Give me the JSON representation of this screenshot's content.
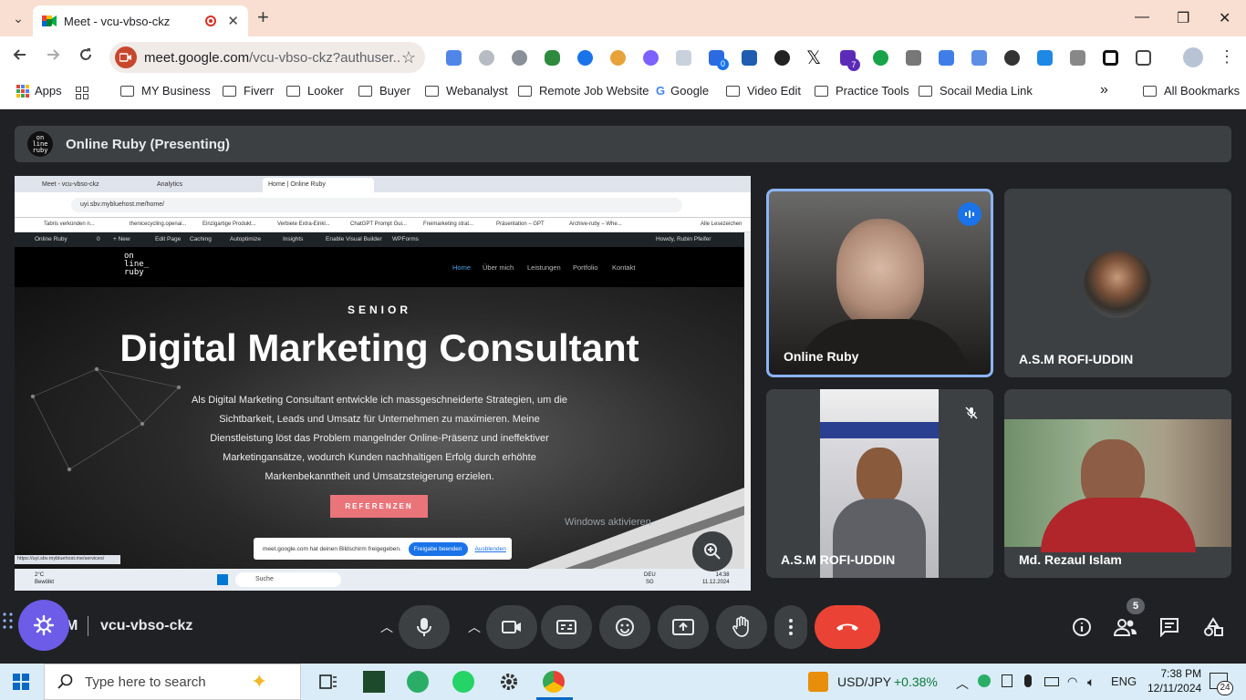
{
  "browser": {
    "tab": {
      "title": "Meet - vcu-vbso-ckz",
      "close": "✕"
    },
    "new_tab": "+",
    "window_controls": {
      "minimize": "—",
      "restore": "❐",
      "close": "✕"
    },
    "url_host": "meet.google.com",
    "url_rest": "/vcu-vbso-ckz?authuser...",
    "extension_badges": {
      "first": "0",
      "second": "7"
    },
    "bookmarks": [
      "Apps",
      "MY Business",
      "Fiverr",
      "Looker",
      "Buyer",
      "Webanalyst",
      "Remote Job Website",
      "Google",
      "Video Edit",
      "Practice Tools",
      "Socail Media Link"
    ],
    "more_bookmarks": "»",
    "all_bookmarks": "All Bookmarks"
  },
  "meet": {
    "presenting_banner": "Online Ruby (Presenting)",
    "presenter_logo": [
      "on",
      "line",
      "ruby"
    ],
    "shared_screen": {
      "tabs": [
        "Meet - vcu-vbso-ckz",
        "Analytics",
        "Home | Online Ruby"
      ],
      "url": "uyi.sbv.mybluehost.me/home/",
      "bookmarks": [
        "Tabris verkünden n...",
        "thenicecycling.openai...",
        "Einzigartige Produkt...",
        "Verbiete Extra-Einkl...",
        "ChatGPT Prompt Gui...",
        "Freimarketing strat...",
        "Präsentation – GPT",
        "Archive-ruby – Whe..."
      ],
      "all_bookmarks": "Alle Lesezeichen",
      "wp_bar": [
        "Online Ruby",
        "0",
        "+ New",
        "Edit Page",
        "Caching",
        "Autoptimize",
        "Insights",
        "Enable Visual Builder",
        "WPForms"
      ],
      "wp_user": "Howdy, Rubin Pfeifer",
      "site_logo": [
        "on",
        "line_",
        "ruby"
      ],
      "nav": [
        "Home",
        "Über mich",
        "Leistungen",
        "Portfolio",
        "Kontakt"
      ],
      "eyebrow": "SENIOR",
      "headline": "Digital Marketing Consultant",
      "body_lines": [
        "Als Digital Marketing Consultant entwickle ich massgeschneiderte Strategien, um die",
        "Sichtbarkeit, Leads und Umsatz für Unternehmen zu maximieren. Meine",
        "Dienstleistung löst das Problem mangelnder Online-Präsenz und ineffektiver",
        "Marketingansätze, wodurch Kunden nachhaltigen Erfolg durch erhöhte",
        "Markenbekanntheit und Umsatzsteigerung erzielen."
      ],
      "cta": "REFERENZEN",
      "watermark": "Windows aktivieren",
      "share_notice": "meet.google.com hat deinen Bildschirm freigegeben.",
      "stop_share": "Freigabe beenden",
      "hide": "Ausblenden",
      "status_url": "https://uyi.sbv.mybluehost.me/services/",
      "taskbar_weather": [
        "2°C",
        "Bewölkt"
      ],
      "taskbar_search": "Suche",
      "taskbar_lang": [
        "DEU",
        "SG"
      ],
      "taskbar_clock": [
        "14:38",
        "11.12.2024"
      ]
    },
    "participants": [
      {
        "name": "Online Ruby",
        "speaking": true
      },
      {
        "name": "A.S.M ROFI-UDDIN",
        "avatar": true
      },
      {
        "name": "A.S.M ROFI-UDDIN",
        "muted": true
      },
      {
        "name": "Md. Rezaul Islam"
      }
    ],
    "meeting_code_prefix": "M",
    "meeting_code": "vcu-vbso-ckz",
    "people_count": "5",
    "colors": {
      "accent": "#1a73e8",
      "end_call": "#ea4335",
      "panel": "#3c4043",
      "bg": "#202124"
    }
  },
  "taskbar": {
    "search_placeholder": "Type here to search",
    "ticker_symbol": "USD/JPY",
    "ticker_change": "+0.38%",
    "lang": "ENG",
    "time": "7:38 PM",
    "date": "12/11/2024",
    "notifications": "24"
  }
}
